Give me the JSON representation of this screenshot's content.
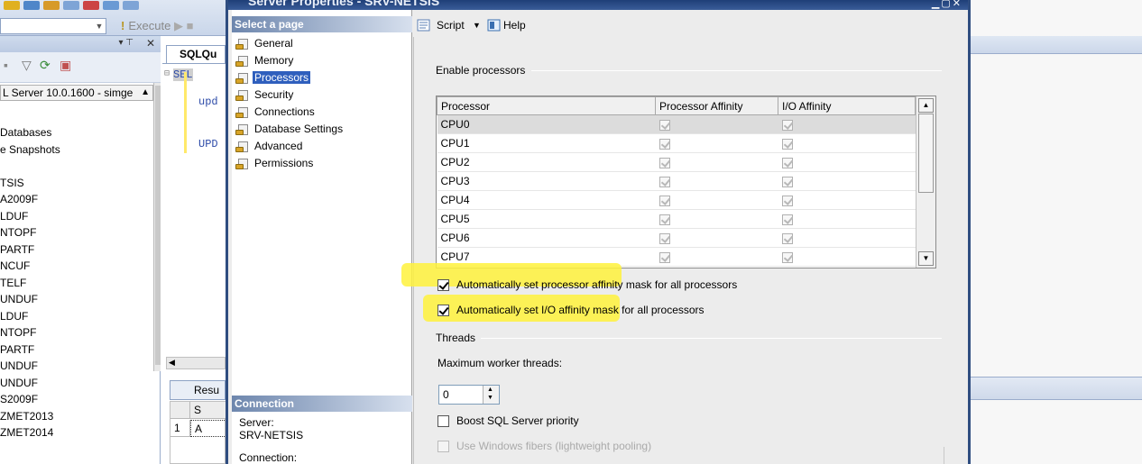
{
  "background": {
    "execute_label": "Execute",
    "object_explorer": {
      "server_node": "L Server 10.0.1600 - simge",
      "items": [
        "Databases",
        "e Snapshots",
        "",
        "TSIS",
        "A2009F",
        "LDUF",
        "NTOPF",
        "PARTF",
        "NCUF",
        "TELF",
        "UNDUF",
        "LDUF",
        "NTOPF",
        "PARTF",
        "UNDUF",
        "UNDUF",
        "S2009F",
        "ZMET2013",
        "ZMET2014"
      ]
    },
    "query": {
      "tab": "SQLQu",
      "line1": "SEL",
      "line2": "upd",
      "line3": "UPD",
      "results_tab": "Resu",
      "grid_col": "S",
      "row_num": "1",
      "row_val": "A"
    }
  },
  "dialog": {
    "title": "Server Properties - SRV-NETSIS",
    "select_page_header": "Select a page",
    "pages": [
      {
        "label": "General",
        "selected": false
      },
      {
        "label": "Memory",
        "selected": false
      },
      {
        "label": "Processors",
        "selected": true
      },
      {
        "label": "Security",
        "selected": false
      },
      {
        "label": "Connections",
        "selected": false
      },
      {
        "label": "Database Settings",
        "selected": false
      },
      {
        "label": "Advanced",
        "selected": false
      },
      {
        "label": "Permissions",
        "selected": false
      }
    ],
    "connection": {
      "header": "Connection",
      "server_label": "Server:",
      "server_value": "SRV-NETSIS",
      "connection_label": "Connection:"
    },
    "toolbar": {
      "script_label": "Script",
      "help_label": "Help"
    },
    "processors": {
      "enable_group": "Enable processors",
      "columns": [
        "Processor",
        "Processor Affinity",
        "I/O Affinity"
      ],
      "rows": [
        {
          "name": "CPU0",
          "processor_affinity": true,
          "io_affinity": true
        },
        {
          "name": "CPU1",
          "processor_affinity": true,
          "io_affinity": true
        },
        {
          "name": "CPU2",
          "processor_affinity": true,
          "io_affinity": true
        },
        {
          "name": "CPU3",
          "processor_affinity": true,
          "io_affinity": true
        },
        {
          "name": "CPU4",
          "processor_affinity": true,
          "io_affinity": true
        },
        {
          "name": "CPU5",
          "processor_affinity": true,
          "io_affinity": true
        },
        {
          "name": "CPU6",
          "processor_affinity": true,
          "io_affinity": true
        },
        {
          "name": "CPU7",
          "processor_affinity": true,
          "io_affinity": true
        }
      ],
      "auto_processor_affinity": {
        "label": "Automatically set processor affinity mask for all processors",
        "checked": true
      },
      "auto_io_affinity": {
        "label": "Automatically set I/O affinity mask for all processors",
        "checked": true
      },
      "threads_group": "Threads",
      "max_worker_threads_label": "Maximum worker threads:",
      "max_worker_threads_value": "0",
      "boost_priority": {
        "label": "Boost SQL Server priority",
        "checked": false
      },
      "windows_fibers": {
        "label": "Use Windows fibers (lightweight pooling)",
        "checked": false,
        "disabled": true
      }
    }
  },
  "colors": {
    "highlight": "#fff23c",
    "selection": "#2f5fbd",
    "title_bar": "#1f3f78"
  }
}
